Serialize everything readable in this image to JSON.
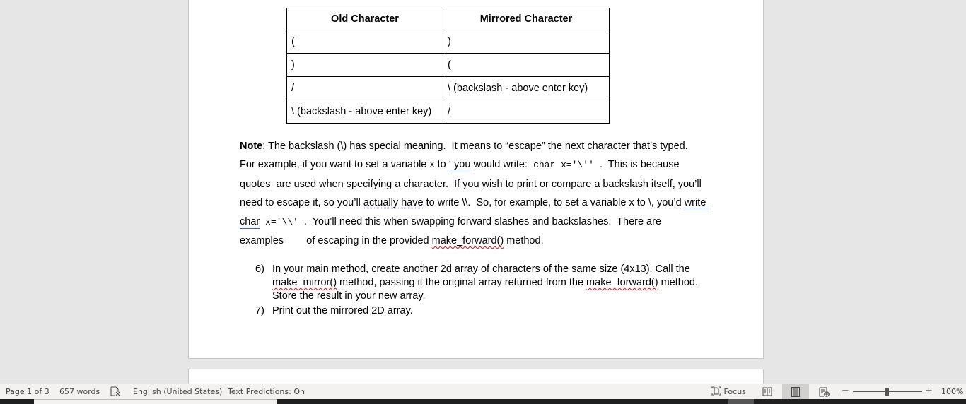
{
  "table": {
    "headers": [
      "Old Character",
      "Mirrored Character"
    ],
    "rows": [
      [
        "(",
        ")"
      ],
      [
        ")",
        "("
      ],
      [
        "/",
        "\\ (backslash - above enter key)"
      ],
      [
        "\\ (backslash - above enter key)",
        "/"
      ]
    ]
  },
  "note": {
    "label": "Note",
    "line1": ": The backslash (\\) has special meaning.  It means to “escape” the next character that’s typed.",
    "line2_a": "For example, if you want to set a variable x to ",
    "line2_quote": "‘ you",
    "line2_b": " would write:  ",
    "line2_code": "char x='\\''",
    "line2_c": "  .  This is because",
    "line3": "quotes  are used when specifying a character.  If you wish to print or compare a backslash itself, you’ll",
    "line4_a": "need to escape it, so you’ll ",
    "line4_dotted": "actually have",
    "line4_b": " to write \\\\.  So, for example, to set a variable x to \\, you’d ",
    "line4_write": "write ",
    "line5_char": "char",
    "line5_code": " x='\\\\'",
    "line5_b": "  .  You’ll need this when swapping forward slashes and backslashes.  There are",
    "line6_a": "examples        of escaping in the provided ",
    "line6_method": "make_forward()",
    "line6_b": " method."
  },
  "steps": [
    {
      "num": "6)",
      "line1": "In your main method, create another 2d array of characters of the same size (4x13).  Call the",
      "line2_method": "make_mirror()",
      "line2_a": " method, passing it the original array returned from the ",
      "line2_method2": "make_forward()",
      "line2_b": " method.",
      "line3": "Store the result in your new array."
    },
    {
      "num": "7)",
      "line1": "Print out the mirrored 2D array."
    }
  ],
  "statusbar": {
    "page": "Page 1 of 3",
    "words": "657 words",
    "proofing_icon": "proofing-icon",
    "language": "English (United States)",
    "predictions": "Text Predictions: On",
    "focus": "Focus",
    "zoom_minus": "−",
    "zoom_plus": "+",
    "zoom_level": "100%",
    "zoom_value_percent": 100
  }
}
